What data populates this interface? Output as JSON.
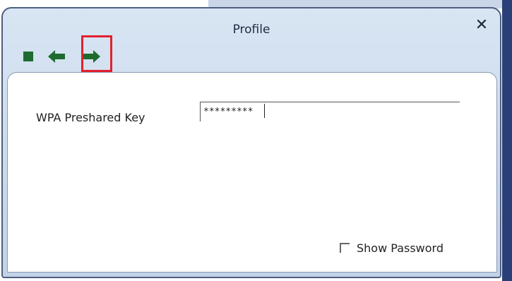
{
  "window": {
    "title": "Profile",
    "close_symbol": "✕"
  },
  "toolbar": {
    "buttons": [
      {
        "name": "stop",
        "icon": "stop-square-icon",
        "color": "#1e6b2f"
      },
      {
        "name": "back",
        "icon": "arrow-left-icon",
        "color": "#1e6b2f"
      },
      {
        "name": "next",
        "icon": "arrow-right-icon",
        "color": "#1e6b2f",
        "highlighted": true
      }
    ],
    "highlight_color": "#e41f2c"
  },
  "form": {
    "key_label": "WPA Preshared Key",
    "key_value": "*********",
    "show_password_label": "Show Password",
    "show_password_checked": false
  }
}
